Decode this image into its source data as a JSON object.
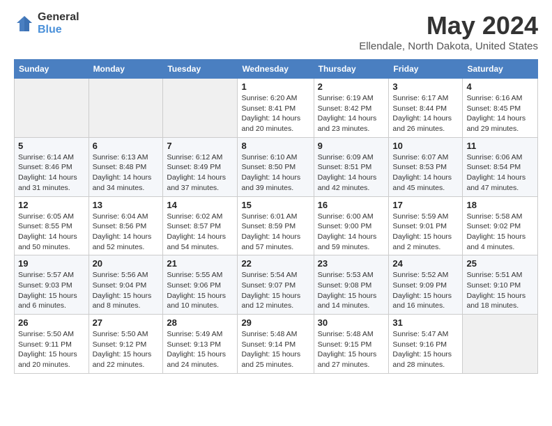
{
  "logo": {
    "general": "General",
    "blue": "Blue"
  },
  "title": "May 2024",
  "subtitle": "Ellendale, North Dakota, United States",
  "headers": [
    "Sunday",
    "Monday",
    "Tuesday",
    "Wednesday",
    "Thursday",
    "Friday",
    "Saturday"
  ],
  "weeks": [
    [
      {
        "day": "",
        "detail": ""
      },
      {
        "day": "",
        "detail": ""
      },
      {
        "day": "",
        "detail": ""
      },
      {
        "day": "1",
        "detail": "Sunrise: 6:20 AM\nSunset: 8:41 PM\nDaylight: 14 hours\nand 20 minutes."
      },
      {
        "day": "2",
        "detail": "Sunrise: 6:19 AM\nSunset: 8:42 PM\nDaylight: 14 hours\nand 23 minutes."
      },
      {
        "day": "3",
        "detail": "Sunrise: 6:17 AM\nSunset: 8:44 PM\nDaylight: 14 hours\nand 26 minutes."
      },
      {
        "day": "4",
        "detail": "Sunrise: 6:16 AM\nSunset: 8:45 PM\nDaylight: 14 hours\nand 29 minutes."
      }
    ],
    [
      {
        "day": "5",
        "detail": "Sunrise: 6:14 AM\nSunset: 8:46 PM\nDaylight: 14 hours\nand 31 minutes."
      },
      {
        "day": "6",
        "detail": "Sunrise: 6:13 AM\nSunset: 8:48 PM\nDaylight: 14 hours\nand 34 minutes."
      },
      {
        "day": "7",
        "detail": "Sunrise: 6:12 AM\nSunset: 8:49 PM\nDaylight: 14 hours\nand 37 minutes."
      },
      {
        "day": "8",
        "detail": "Sunrise: 6:10 AM\nSunset: 8:50 PM\nDaylight: 14 hours\nand 39 minutes."
      },
      {
        "day": "9",
        "detail": "Sunrise: 6:09 AM\nSunset: 8:51 PM\nDaylight: 14 hours\nand 42 minutes."
      },
      {
        "day": "10",
        "detail": "Sunrise: 6:07 AM\nSunset: 8:53 PM\nDaylight: 14 hours\nand 45 minutes."
      },
      {
        "day": "11",
        "detail": "Sunrise: 6:06 AM\nSunset: 8:54 PM\nDaylight: 14 hours\nand 47 minutes."
      }
    ],
    [
      {
        "day": "12",
        "detail": "Sunrise: 6:05 AM\nSunset: 8:55 PM\nDaylight: 14 hours\nand 50 minutes."
      },
      {
        "day": "13",
        "detail": "Sunrise: 6:04 AM\nSunset: 8:56 PM\nDaylight: 14 hours\nand 52 minutes."
      },
      {
        "day": "14",
        "detail": "Sunrise: 6:02 AM\nSunset: 8:57 PM\nDaylight: 14 hours\nand 54 minutes."
      },
      {
        "day": "15",
        "detail": "Sunrise: 6:01 AM\nSunset: 8:59 PM\nDaylight: 14 hours\nand 57 minutes."
      },
      {
        "day": "16",
        "detail": "Sunrise: 6:00 AM\nSunset: 9:00 PM\nDaylight: 14 hours\nand 59 minutes."
      },
      {
        "day": "17",
        "detail": "Sunrise: 5:59 AM\nSunset: 9:01 PM\nDaylight: 15 hours\nand 2 minutes."
      },
      {
        "day": "18",
        "detail": "Sunrise: 5:58 AM\nSunset: 9:02 PM\nDaylight: 15 hours\nand 4 minutes."
      }
    ],
    [
      {
        "day": "19",
        "detail": "Sunrise: 5:57 AM\nSunset: 9:03 PM\nDaylight: 15 hours\nand 6 minutes."
      },
      {
        "day": "20",
        "detail": "Sunrise: 5:56 AM\nSunset: 9:04 PM\nDaylight: 15 hours\nand 8 minutes."
      },
      {
        "day": "21",
        "detail": "Sunrise: 5:55 AM\nSunset: 9:06 PM\nDaylight: 15 hours\nand 10 minutes."
      },
      {
        "day": "22",
        "detail": "Sunrise: 5:54 AM\nSunset: 9:07 PM\nDaylight: 15 hours\nand 12 minutes."
      },
      {
        "day": "23",
        "detail": "Sunrise: 5:53 AM\nSunset: 9:08 PM\nDaylight: 15 hours\nand 14 minutes."
      },
      {
        "day": "24",
        "detail": "Sunrise: 5:52 AM\nSunset: 9:09 PM\nDaylight: 15 hours\nand 16 minutes."
      },
      {
        "day": "25",
        "detail": "Sunrise: 5:51 AM\nSunset: 9:10 PM\nDaylight: 15 hours\nand 18 minutes."
      }
    ],
    [
      {
        "day": "26",
        "detail": "Sunrise: 5:50 AM\nSunset: 9:11 PM\nDaylight: 15 hours\nand 20 minutes."
      },
      {
        "day": "27",
        "detail": "Sunrise: 5:50 AM\nSunset: 9:12 PM\nDaylight: 15 hours\nand 22 minutes."
      },
      {
        "day": "28",
        "detail": "Sunrise: 5:49 AM\nSunset: 9:13 PM\nDaylight: 15 hours\nand 24 minutes."
      },
      {
        "day": "29",
        "detail": "Sunrise: 5:48 AM\nSunset: 9:14 PM\nDaylight: 15 hours\nand 25 minutes."
      },
      {
        "day": "30",
        "detail": "Sunrise: 5:48 AM\nSunset: 9:15 PM\nDaylight: 15 hours\nand 27 minutes."
      },
      {
        "day": "31",
        "detail": "Sunrise: 5:47 AM\nSunset: 9:16 PM\nDaylight: 15 hours\nand 28 minutes."
      },
      {
        "day": "",
        "detail": ""
      }
    ]
  ]
}
